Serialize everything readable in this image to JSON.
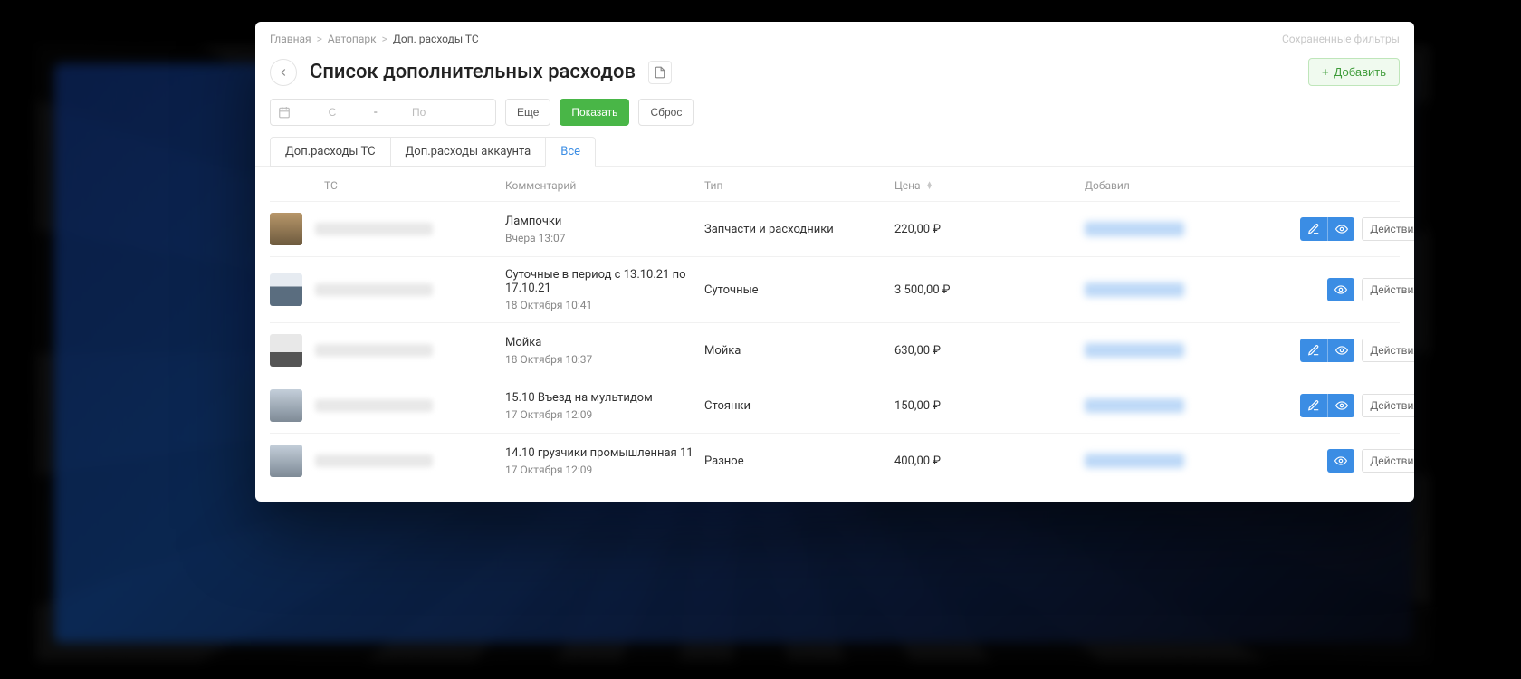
{
  "breadcrumb": {
    "items": [
      "Главная",
      "Автопарк",
      "Доп. расходы ТС"
    ],
    "separator": ">"
  },
  "topRight": {
    "savedFilters": "Сохраненные фильтры"
  },
  "header": {
    "title": "Список дополнительных расходов",
    "addButton": "Добавить"
  },
  "filters": {
    "from_placeholder": "С",
    "to_placeholder": "По",
    "more": "Еще",
    "apply": "Показать",
    "reset": "Сброс"
  },
  "tabs": {
    "items": [
      {
        "label": "Доп.расходы ТС",
        "active": false
      },
      {
        "label": "Доп.расходы аккаунта",
        "active": false
      },
      {
        "label": "Все",
        "active": true
      }
    ]
  },
  "table": {
    "columns": {
      "vehicle": "ТС",
      "comment": "Комментарий",
      "type": "Тип",
      "price": "Цена",
      "added_by": "Добавил"
    },
    "actionsLabel": "Действия",
    "rows": [
      {
        "thumb": "t1",
        "comment": "Лампочки",
        "date": "Вчера 13:07",
        "type": "Запчасти и расходники",
        "price": "220,00 ₽",
        "hasEdit": true
      },
      {
        "thumb": "t2",
        "comment": "Суточные в период с 13.10.21 по 17.10.21",
        "date": "18 Октября 10:41",
        "type": "Суточные",
        "price": "3 500,00 ₽",
        "hasEdit": false
      },
      {
        "thumb": "t3",
        "comment": "Мойка",
        "date": "18 Октября 10:37",
        "type": "Мойка",
        "price": "630,00 ₽",
        "hasEdit": true
      },
      {
        "thumb": "t4",
        "comment": "15.10 Въезд на мультидом",
        "date": "17 Октября 12:09",
        "type": "Стоянки",
        "price": "150,00 ₽",
        "hasEdit": true
      },
      {
        "thumb": "t5",
        "comment": "14.10 грузчики промышленная 11",
        "date": "17 Октября 12:09",
        "type": "Разное",
        "price": "400,00 ₽",
        "hasEdit": false
      }
    ]
  }
}
